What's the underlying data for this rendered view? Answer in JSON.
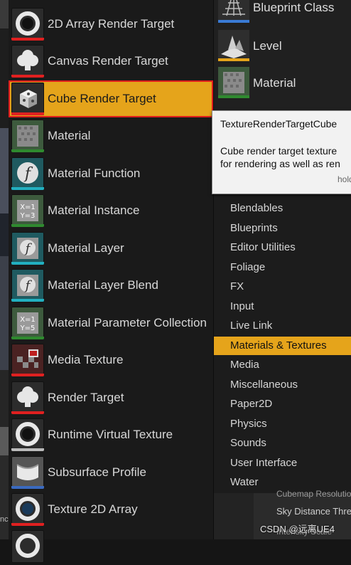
{
  "left_menu": {
    "items": [
      {
        "label": "2D Array Render Target",
        "icon": "ring-icon",
        "bar": "#e02020"
      },
      {
        "label": "Canvas Render Target",
        "icon": "cloud-icon",
        "bar": "#e02020"
      },
      {
        "label": "Cube Render Target",
        "icon": "cube-icon",
        "bar": "#e02020",
        "selected": true
      },
      {
        "label": "Material",
        "icon": "material-sphere-icon",
        "bar": "#2f8a2f"
      },
      {
        "label": "Material Function",
        "icon": "function-icon",
        "bar": "#22b0c0"
      },
      {
        "label": "Material Instance",
        "icon": "equation-icon",
        "bar": "#2f8a2f"
      },
      {
        "label": "Material Layer",
        "icon": "function-icon",
        "bar": "#22b0c0"
      },
      {
        "label": "Material Layer Blend",
        "icon": "function-icon",
        "bar": "#22b0c0"
      },
      {
        "label": "Material Parameter Collection",
        "icon": "equation-icon",
        "bar": "#2f8a2f"
      },
      {
        "label": "Media Texture",
        "icon": "media-texture-icon",
        "bar": "#e02020"
      },
      {
        "label": "Render Target",
        "icon": "cloud-icon",
        "bar": "#e02020"
      },
      {
        "label": "Runtime Virtual Texture",
        "icon": "ring-icon",
        "bar": "#bbbbbb"
      },
      {
        "label": "Subsurface Profile",
        "icon": "subsurface-icon",
        "bar": "#3a6ac0"
      },
      {
        "label": "Texture 2D Array",
        "icon": "ring-icon",
        "bar": "#e02020"
      },
      {
        "label": "",
        "icon": "ring-icon",
        "bar": "#e02020"
      }
    ]
  },
  "right_top": {
    "items": [
      {
        "label": "Blueprint Class",
        "icon": "grid-plane-icon",
        "bar": "#3a7bd5"
      },
      {
        "label": "Level",
        "icon": "level-icon",
        "bar": "#e5a41b"
      },
      {
        "label": "Material",
        "icon": "material-sphere-icon",
        "bar": "#2f8a2f"
      }
    ]
  },
  "tooltip": {
    "title": "TextureRenderTargetCube",
    "desc_line1": "Cube render target texture",
    "desc_line2": "for rendering as well as ren",
    "hint": "hold"
  },
  "categories": {
    "items": [
      "Blendables",
      "Blueprints",
      "Editor Utilities",
      "Foliage",
      "FX",
      "Input",
      "Live Link",
      "Materials & Textures",
      "Media",
      "Miscellaneous",
      "Paper2D",
      "Physics",
      "Sounds",
      "User Interface",
      "Water"
    ],
    "active": "Materials & Textures"
  },
  "details": {
    "row1": "Cubemap Resolution",
    "row2": "Sky Distance Thre",
    "row3": "Intensity Scale"
  },
  "watermark": "CSDN @远离UE4",
  "edge_text": "nc",
  "colors": {
    "accent": "#e5a41b",
    "selection_outline": "#e01d1d"
  }
}
